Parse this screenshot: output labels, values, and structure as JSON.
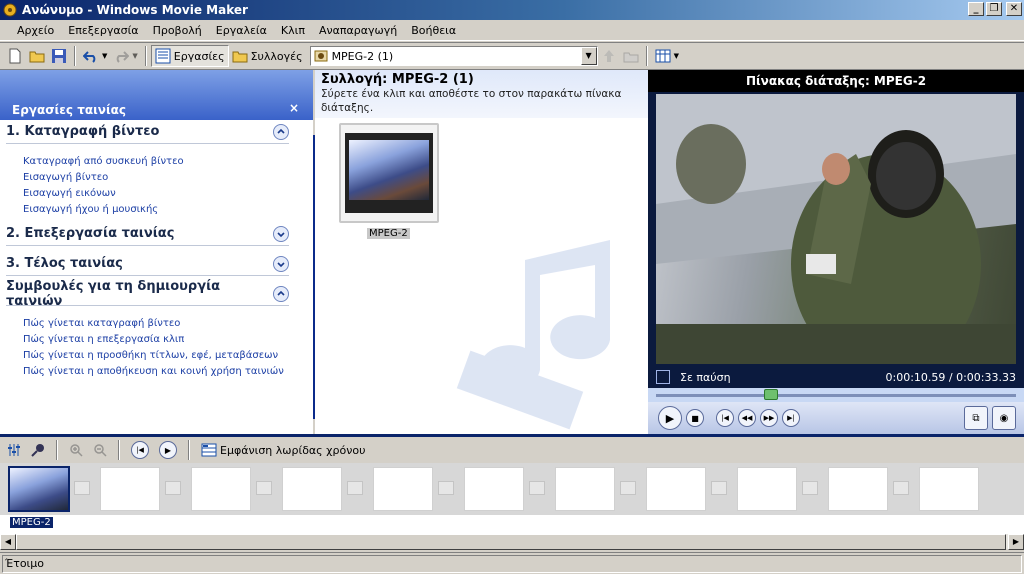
{
  "window": {
    "title": "Ανώνυμο - Windows Movie Maker"
  },
  "menu": [
    "Αρχείο",
    "Επεξεργασία",
    "Προβολή",
    "Εργαλεία",
    "Κλιπ",
    "Αναπαραγωγή",
    "Βοήθεια"
  ],
  "toolbar": {
    "tasks_label": "Εργασίες",
    "collections_label": "Συλλογές",
    "collection_combo": "MPEG-2 (1)"
  },
  "taskpane": {
    "title": "Εργασίες ταινίας",
    "close": "×",
    "sections": [
      {
        "title": "1. Καταγραφή βίντεο",
        "expanded": true,
        "links": [
          "Καταγραφή από συσκευή βίντεο",
          "Εισαγωγή βίντεο",
          "Εισαγωγή εικόνων",
          "Εισαγωγή ήχου ή μουσικής"
        ]
      },
      {
        "title": "2. Επεξεργασία ταινίας",
        "expanded": false,
        "links": []
      },
      {
        "title": "3. Τέλος ταινίας",
        "expanded": false,
        "links": []
      },
      {
        "title": "Συμβουλές για τη δημιουργία ταινιών",
        "expanded": true,
        "links": [
          "Πώς γίνεται καταγραφή βίντεο",
          "Πώς γίνεται η επεξεργασία κλιπ",
          "Πώς γίνεται η προσθήκη τίτλων, εφέ, μεταβάσεων",
          "Πώς γίνεται η αποθήκευση και κοινή χρήση ταινιών"
        ]
      }
    ]
  },
  "collection": {
    "title": "Συλλογή: MPEG-2 (1)",
    "description": "Σύρετε ένα κλιπ και αποθέστε το στον παρακάτω πίνακα διάταξης.",
    "clips": [
      {
        "label": "MPEG-2"
      }
    ]
  },
  "preview": {
    "title": "Πίνακας διάταξης: MPEG-2",
    "status": "Σε παύση",
    "time": "0:00:10.59 / 0:00:33.33",
    "progress": 0.32
  },
  "storyboard": {
    "toggle_label": "Εμφάνιση λωρίδας χρόνου",
    "clip_label": "MPEG-2",
    "empty_cells": 10
  },
  "status": {
    "text": "Έτοιμο"
  },
  "colors": {
    "title_start": "#0a246a",
    "link": "#1c3fa5",
    "preview_bg": "#0b1a3e"
  }
}
